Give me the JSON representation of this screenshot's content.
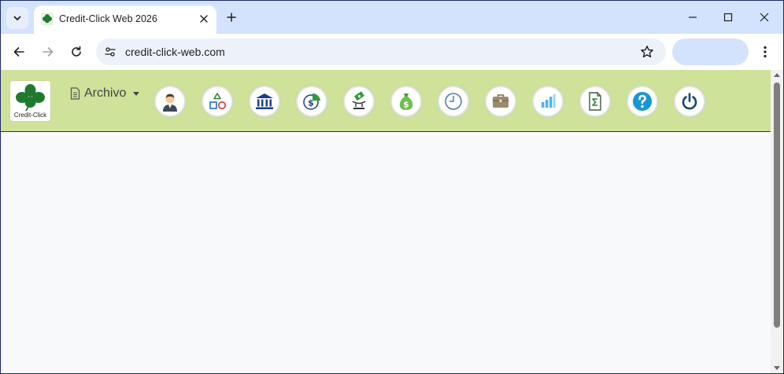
{
  "browser": {
    "tab": {
      "title": "Credit-Click Web 2026"
    },
    "address_bar": {
      "url": "credit-click-web.com"
    }
  },
  "app": {
    "logo_text": "Credit-Click",
    "menu": {
      "archivo_label": "Archivo"
    },
    "accent_color": "#cee29a",
    "toolbar_icons": [
      {
        "name": "user-icon"
      },
      {
        "name": "shapes-icon"
      },
      {
        "name": "bank-icon"
      },
      {
        "name": "dollar-chart-icon"
      },
      {
        "name": "money-transfer-icon"
      },
      {
        "name": "money-bag-icon"
      },
      {
        "name": "clock-icon"
      },
      {
        "name": "briefcase-icon"
      },
      {
        "name": "bar-chart-icon"
      },
      {
        "name": "sum-document-icon"
      },
      {
        "name": "help-icon"
      },
      {
        "name": "power-icon"
      }
    ]
  }
}
